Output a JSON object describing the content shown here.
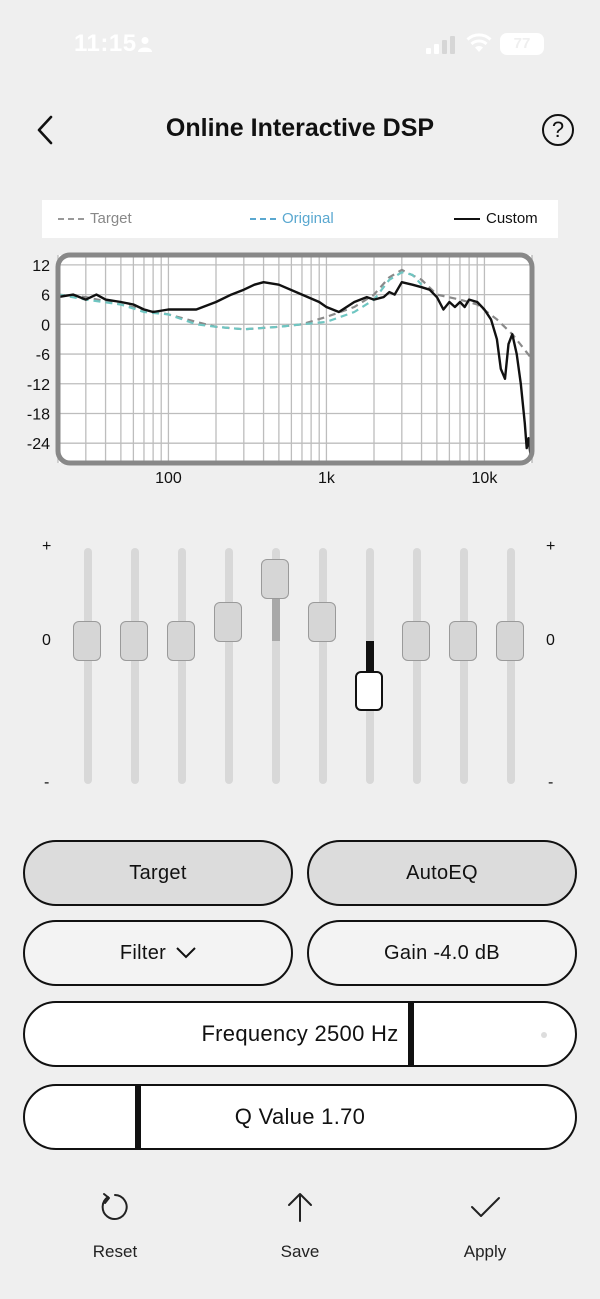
{
  "status": {
    "time": "11:15",
    "battery": "77"
  },
  "header": {
    "title": "Online Interactive DSP",
    "help": "?"
  },
  "legend": {
    "target": "Target",
    "original": "Original",
    "custom": "Custom"
  },
  "chart_data": {
    "type": "line",
    "x_scale": "log",
    "xlim": [
      20,
      20000
    ],
    "ylim": [
      -28,
      14
    ],
    "y_ticks": [
      "12",
      "6",
      "0",
      "-6",
      "-12",
      "-18",
      "-24"
    ],
    "x_ticks": [
      "100",
      "1k",
      "10k"
    ],
    "grid": true,
    "series": [
      {
        "name": "Target",
        "style": "dashed",
        "color": "#8a8a8a",
        "points": [
          [
            20,
            6
          ],
          [
            30,
            5.5
          ],
          [
            50,
            4
          ],
          [
            70,
            3
          ],
          [
            100,
            2
          ],
          [
            150,
            0.5
          ],
          [
            200,
            -0.5
          ],
          [
            300,
            -1
          ],
          [
            500,
            -0.5
          ],
          [
            700,
            0
          ],
          [
            1000,
            1.5
          ],
          [
            1500,
            3.5
          ],
          [
            2000,
            6
          ],
          [
            2500,
            9.5
          ],
          [
            3000,
            11
          ],
          [
            4000,
            9
          ],
          [
            5000,
            6
          ],
          [
            7000,
            5
          ],
          [
            9000,
            4
          ],
          [
            12000,
            1
          ],
          [
            15000,
            -2
          ],
          [
            20000,
            -7
          ]
        ]
      },
      {
        "name": "Original",
        "style": "dashed",
        "color": "#6fc6c2",
        "points": [
          [
            20,
            6
          ],
          [
            30,
            5
          ],
          [
            50,
            4
          ],
          [
            70,
            2.5
          ],
          [
            100,
            2
          ],
          [
            150,
            0
          ],
          [
            200,
            -0.5
          ],
          [
            300,
            -1
          ],
          [
            500,
            -0.5
          ],
          [
            700,
            0
          ],
          [
            1000,
            0.5
          ],
          [
            1500,
            2.5
          ],
          [
            2000,
            5
          ],
          [
            2500,
            9
          ],
          [
            3000,
            10.5
          ],
          [
            3500,
            10
          ],
          [
            4000,
            8
          ]
        ]
      },
      {
        "name": "Custom",
        "style": "solid",
        "color": "#111111",
        "points": [
          [
            20,
            5.5
          ],
          [
            25,
            6
          ],
          [
            30,
            5
          ],
          [
            35,
            6
          ],
          [
            40,
            5
          ],
          [
            50,
            4.5
          ],
          [
            60,
            4
          ],
          [
            70,
            3
          ],
          [
            80,
            2.5
          ],
          [
            100,
            3
          ],
          [
            150,
            3
          ],
          [
            200,
            4.5
          ],
          [
            250,
            6
          ],
          [
            300,
            7
          ],
          [
            350,
            8
          ],
          [
            400,
            8.5
          ],
          [
            500,
            8
          ],
          [
            700,
            6
          ],
          [
            900,
            4.5
          ],
          [
            1000,
            3.5
          ],
          [
            1200,
            2.5
          ],
          [
            1500,
            4.5
          ],
          [
            1800,
            5.5
          ],
          [
            2000,
            5
          ],
          [
            2300,
            5.5
          ],
          [
            2500,
            6.5
          ],
          [
            2700,
            6
          ],
          [
            3000,
            8.5
          ],
          [
            3500,
            8
          ],
          [
            4000,
            7.5
          ],
          [
            4500,
            7
          ],
          [
            5000,
            5.5
          ],
          [
            5500,
            3
          ],
          [
            6000,
            4.5
          ],
          [
            6500,
            3.5
          ],
          [
            7000,
            4.5
          ],
          [
            7500,
            3.5
          ],
          [
            8000,
            5
          ],
          [
            9000,
            4.5
          ],
          [
            10000,
            3
          ],
          [
            11000,
            1
          ],
          [
            12000,
            -3
          ],
          [
            12700,
            -9
          ],
          [
            13500,
            -11
          ],
          [
            14200,
            -4
          ],
          [
            15000,
            -2
          ],
          [
            16000,
            -6
          ],
          [
            17000,
            -12
          ],
          [
            18000,
            -20
          ],
          [
            18500,
            -25
          ],
          [
            19000,
            -23
          ],
          [
            19500,
            -26
          ],
          [
            20000,
            -22
          ]
        ]
      }
    ]
  },
  "eq": {
    "plus_label": "+",
    "zero_label": "0",
    "minus_label": "-",
    "bands": [
      {
        "gain": 0,
        "active": false
      },
      {
        "gain": 0,
        "active": false
      },
      {
        "gain": 0,
        "active": false
      },
      {
        "gain": 1.5,
        "active": false
      },
      {
        "gain": 5.0,
        "active": false
      },
      {
        "gain": 1.5,
        "active": false
      },
      {
        "gain": -4.0,
        "active": true
      },
      {
        "gain": 0,
        "active": false
      },
      {
        "gain": 0,
        "active": false
      },
      {
        "gain": 0,
        "active": false
      }
    ],
    "range": 6
  },
  "controls": {
    "target_label": "Target",
    "autoeq_label": "AutoEQ",
    "filter_label": "Filter",
    "gain_label": "Gain -4.0 dB",
    "frequency_label": "Frequency 2500 Hz",
    "frequency_fraction": 0.696,
    "q_label": "Q Value 1.70",
    "q_fraction": 0.2
  },
  "bottom": {
    "reset": "Reset",
    "save": "Save",
    "apply": "Apply"
  },
  "colors": {
    "background": "#efefef",
    "graph_frame": "#888888",
    "original": "#6fc6c2",
    "target": "#8a8a8a",
    "custom": "#111111"
  }
}
